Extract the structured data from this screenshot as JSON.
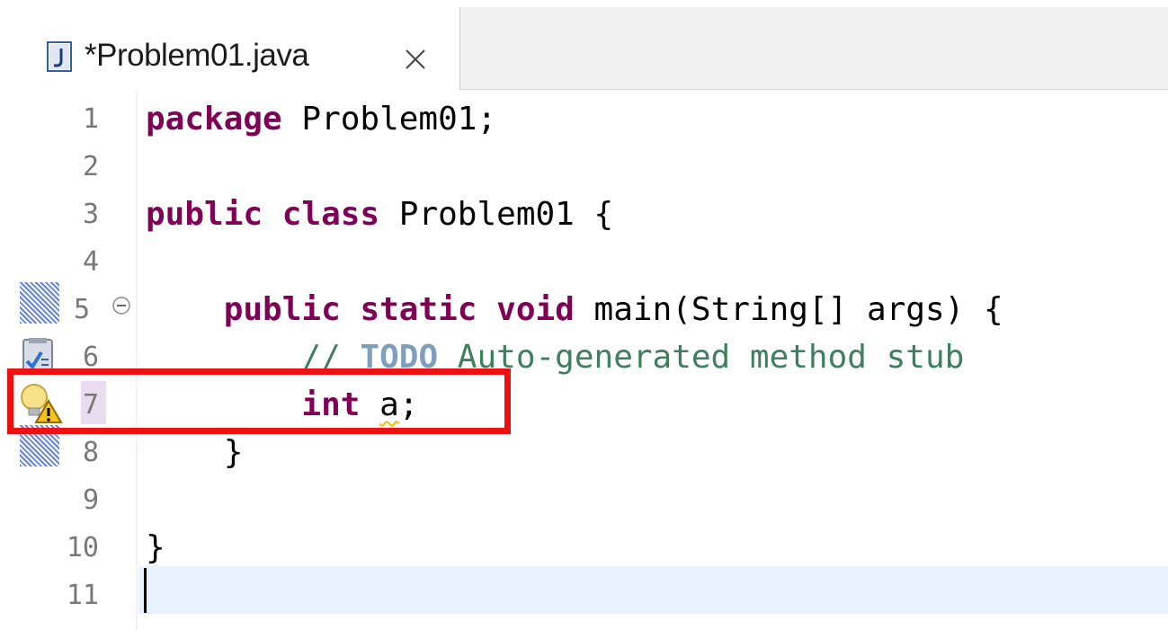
{
  "tab": {
    "title": "*Problem01.java",
    "file_icon": "java-file-icon",
    "close_icon": "close-icon"
  },
  "editor": {
    "lines": [
      {
        "number": "1"
      },
      {
        "number": "2"
      },
      {
        "number": "3"
      },
      {
        "number": "4"
      },
      {
        "number": "5"
      },
      {
        "number": "6"
      },
      {
        "number": "7"
      },
      {
        "number": "8"
      },
      {
        "number": "9"
      },
      {
        "number": "10"
      },
      {
        "number": "11"
      }
    ],
    "code": {
      "l1_kw": "package",
      "l1_rest": " Problem01;",
      "l3_kw1": "public",
      "l3_kw2": "class",
      "l3_rest": " Problem01 {",
      "l5_indent": "    ",
      "l5_kw1": "public",
      "l5_kw2": "static",
      "l5_kw3": "void",
      "l5_rest": " main(String[] args) {",
      "l6_indent": "        ",
      "l6_comment_start": "// ",
      "l6_todo": "TODO",
      "l6_comment_rest": " Auto-generated method stub",
      "l7_indent": "        ",
      "l7_kw": "int",
      "l7_space": " ",
      "l7_var": "a",
      "l7_end": ";",
      "l8_text": "    }",
      "l10_text": "}"
    },
    "gutter_icons": [
      "fold-collapse-icon",
      "task-marker-icon",
      "quick-fix-warning-icon"
    ],
    "annotation_color": "#ee1111",
    "keyword_color": "#7f0055",
    "comment_color": "#3f7f5f"
  }
}
